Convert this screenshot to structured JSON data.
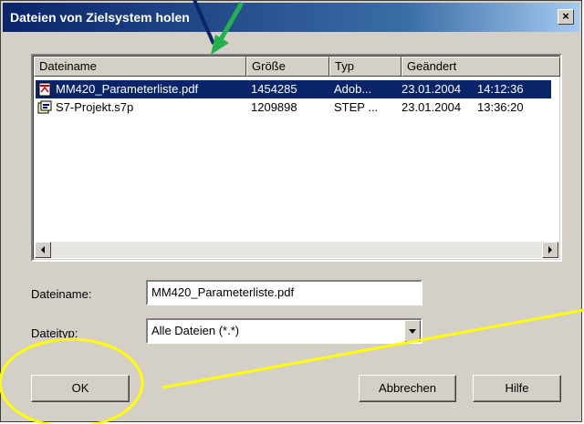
{
  "window": {
    "title": "Dateien von Zielsystem holen",
    "close_label": "×"
  },
  "list": {
    "columns": [
      "Dateiname",
      "Größe",
      "Typ",
      "Geändert"
    ],
    "rows": [
      {
        "name": "MM420_Parameterliste.pdf",
        "size": "1454285",
        "type": "Adob...",
        "date": "23.01.2004",
        "time": "14:12:36",
        "selected": true,
        "icon": "pdf-file-icon"
      },
      {
        "name": "S7-Projekt.s7p",
        "size": "1209898",
        "type": "STEP ...",
        "date": "23.01.2004",
        "time": "13:36:20",
        "selected": false,
        "icon": "s7-project-file-icon"
      }
    ]
  },
  "form": {
    "filename_label": "Dateiname:",
    "filename_value": "MM420_Parameterliste.pdf",
    "filetype_label": "Dateityp:",
    "filetype_value": "Alle Dateien (*.*)"
  },
  "buttons": {
    "ok": "OK",
    "cancel": "Abbrechen",
    "help": "Hilfe"
  },
  "annotations": {
    "arrow_color": "#22b14c",
    "highlight_color": "#ffff00"
  }
}
